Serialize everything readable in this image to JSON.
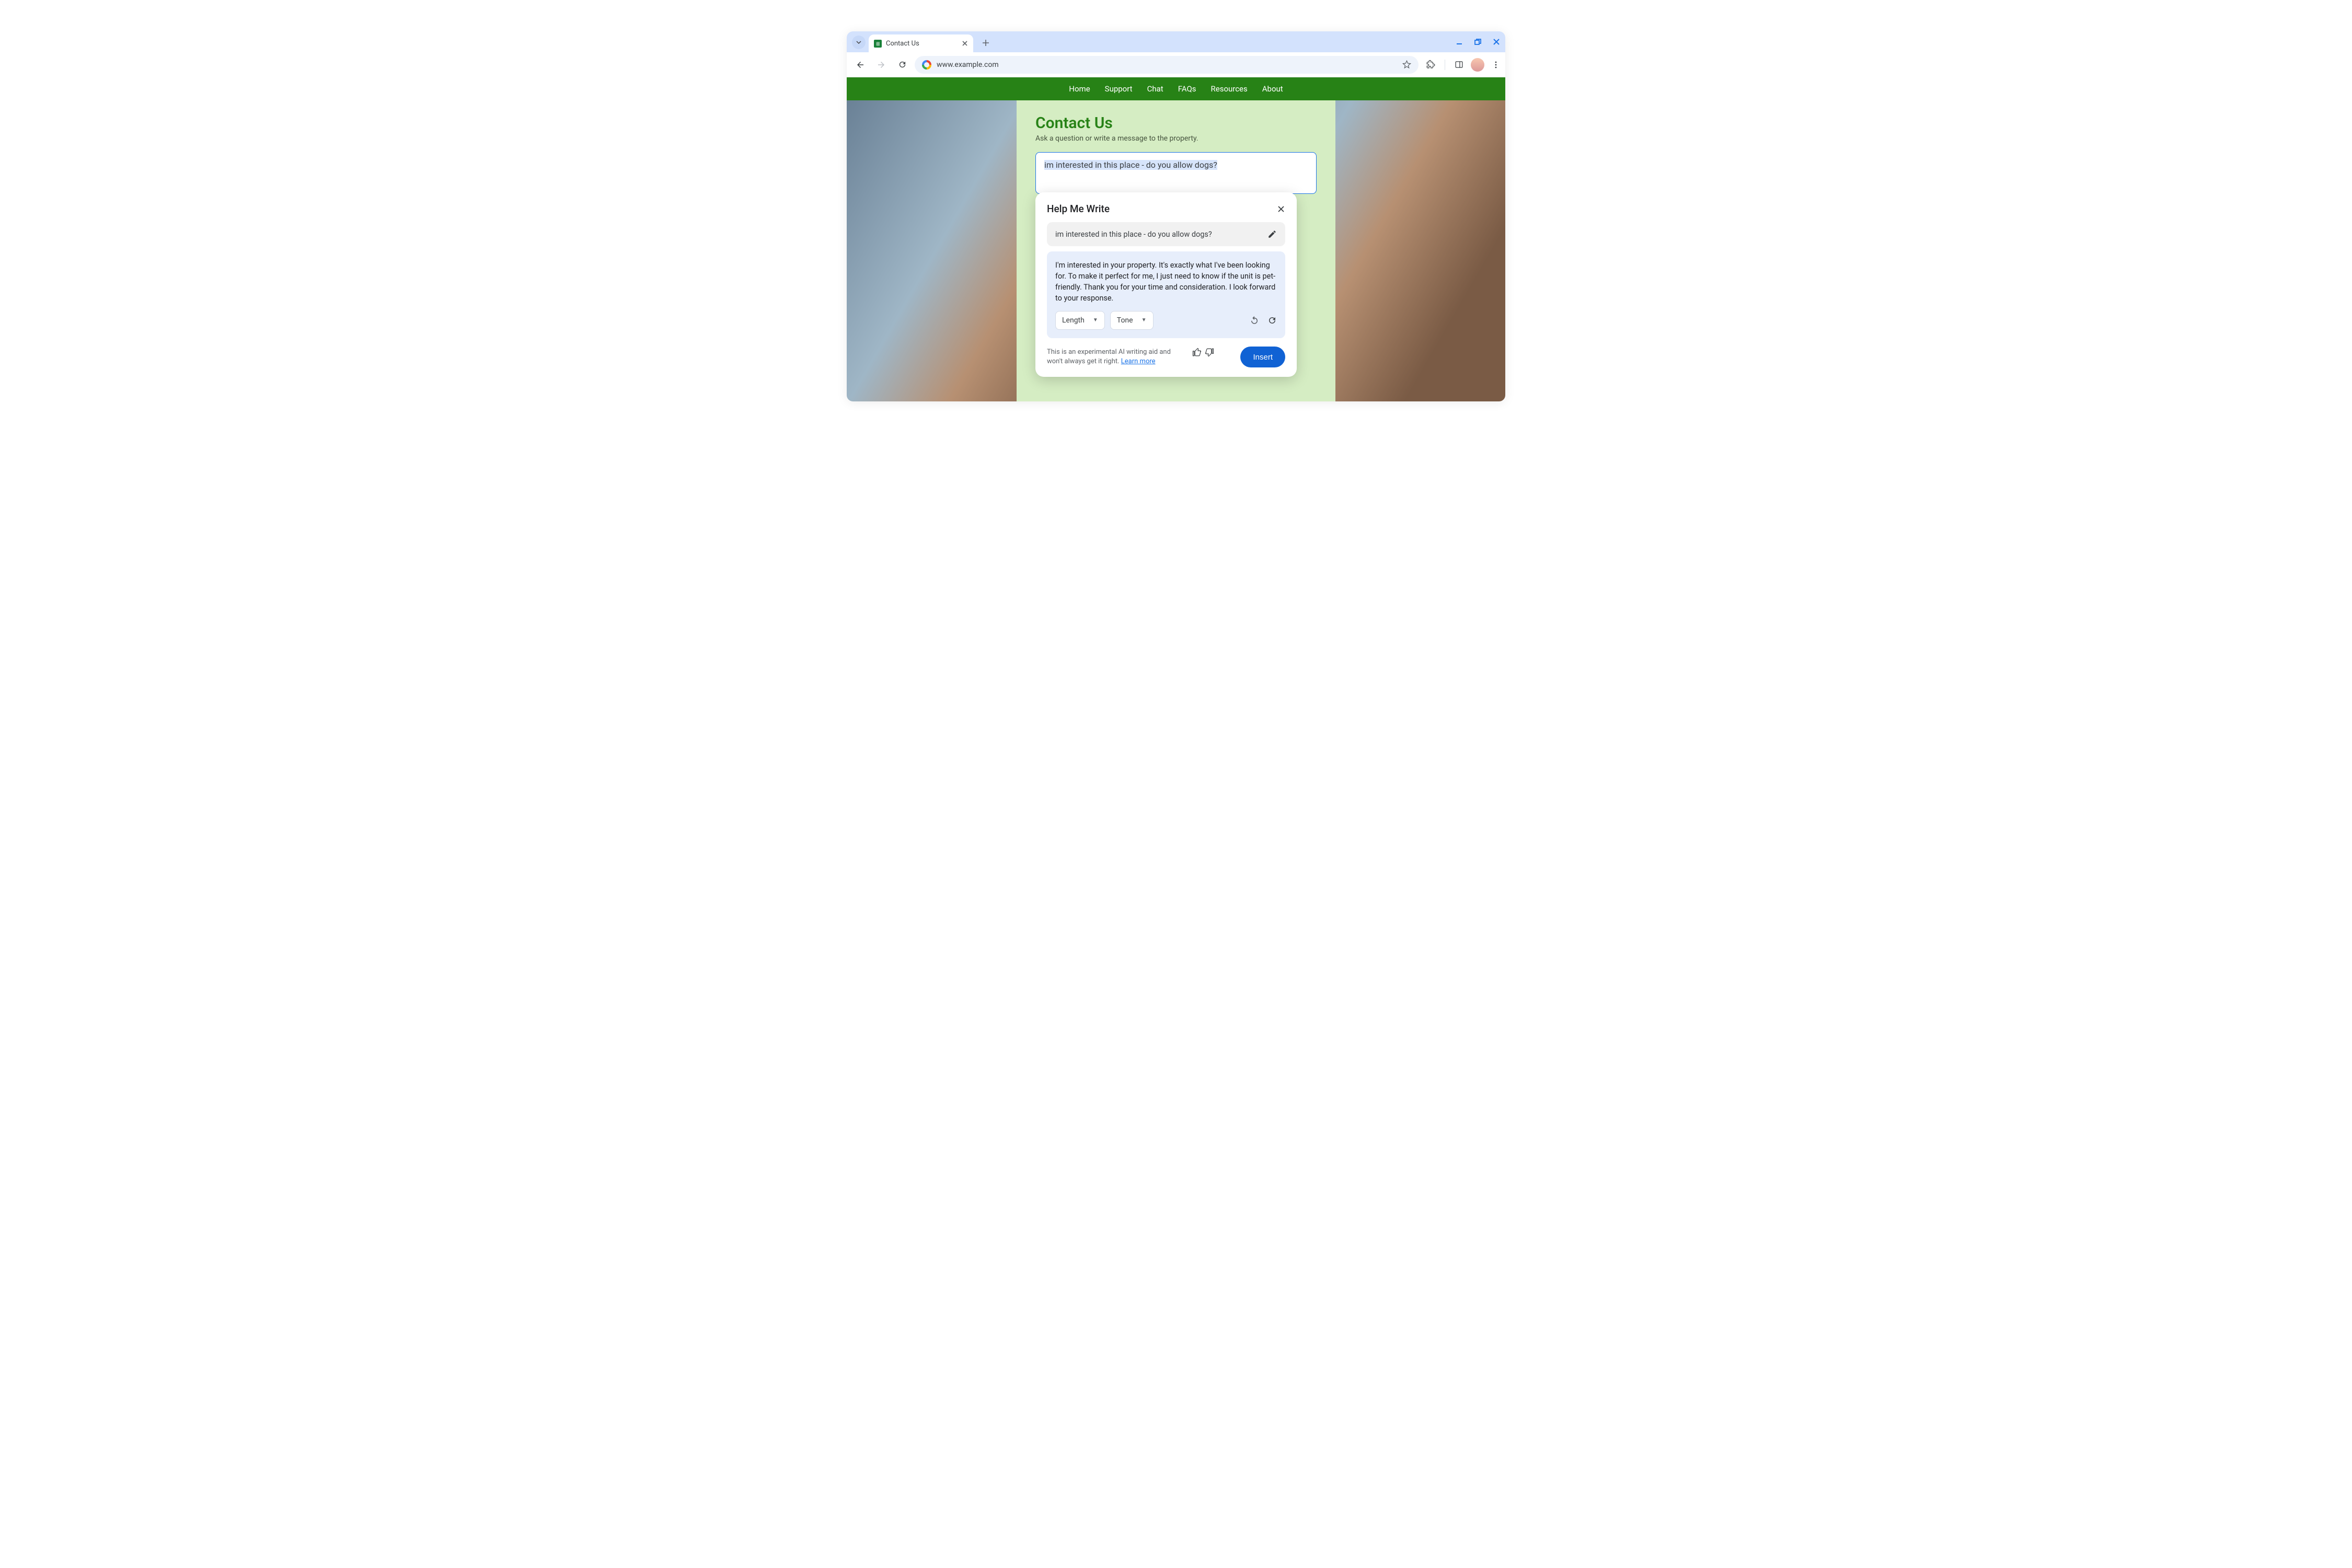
{
  "tab": {
    "title": "Contact Us"
  },
  "url": "www.example.com",
  "nav": {
    "items": [
      "Home",
      "Support",
      "Chat",
      "FAQs",
      "Resources",
      "About"
    ]
  },
  "page": {
    "heading": "Contact Us",
    "subtitle": "Ask a question or write a message to the property.",
    "input_value": "im interested in this place - do you allow dogs?"
  },
  "popover": {
    "title": "Help Me Write",
    "prompt": "im interested in this place - do you allow dogs?",
    "result": "I'm interested in your property. It's exactly what I've been looking for. To make it perfect for me, I just need to know if the unit is pet-friendly. Thank you for your time and consideration. I look forward to your response.",
    "length_label": "Length",
    "tone_label": "Tone",
    "disclaimer_text": "This is an experimental AI writing aid and won't always get it right. ",
    "learn_more": "Learn more",
    "insert_label": "Insert"
  }
}
